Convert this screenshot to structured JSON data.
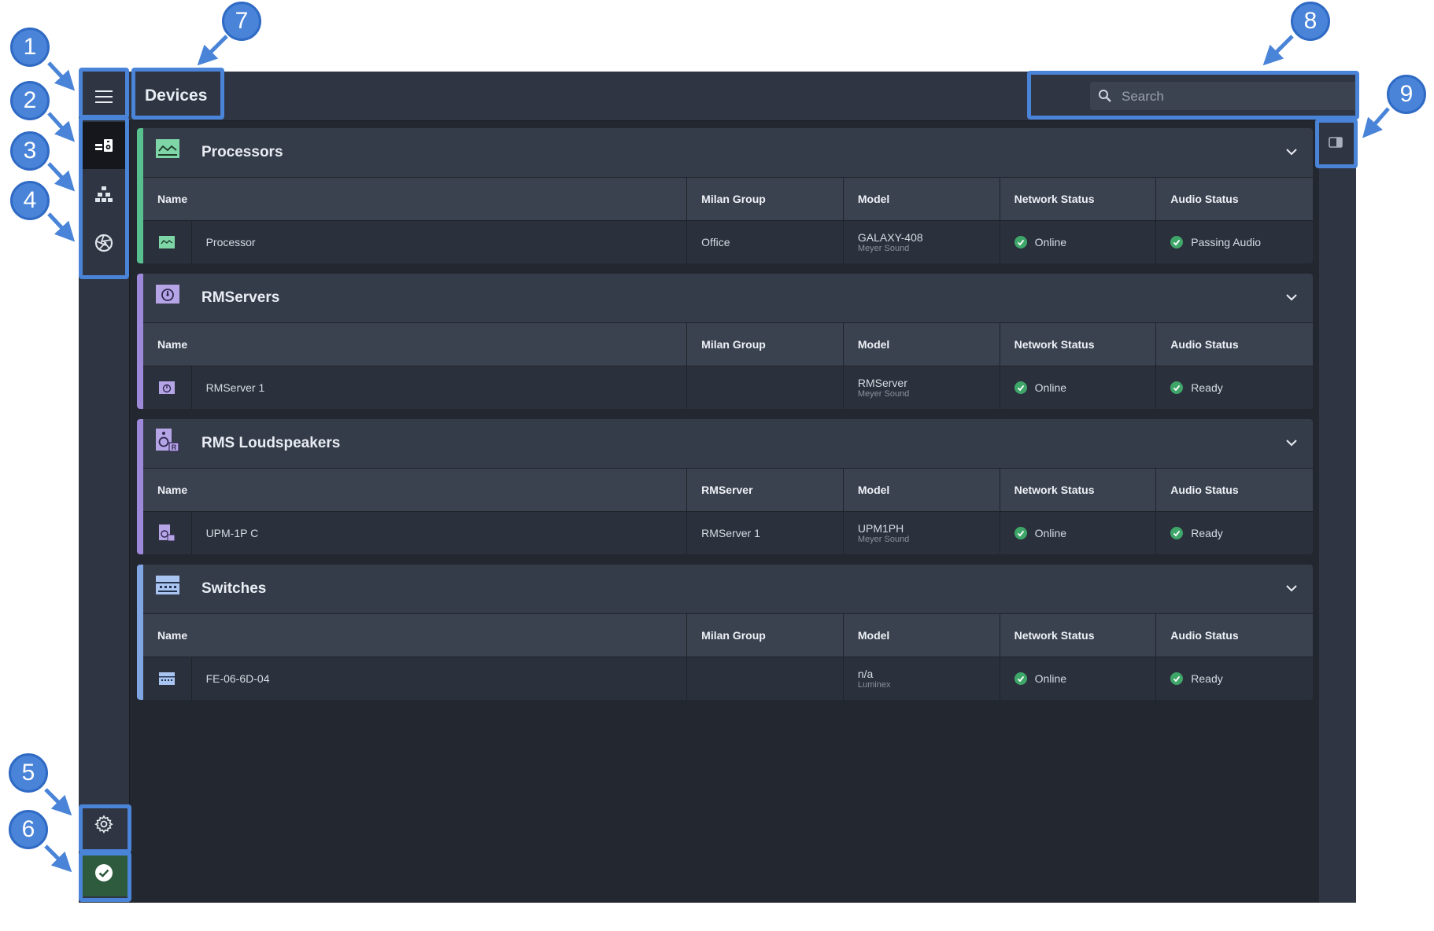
{
  "app": {
    "title": "Devices",
    "search": {
      "placeholder": "Search",
      "value": ""
    }
  },
  "sidebar": {
    "items": [
      {
        "name": "menu",
        "icon": "hamburger-icon"
      },
      {
        "name": "devices",
        "icon": "devices-icon",
        "active": true
      },
      {
        "name": "network",
        "icon": "network-tree-icon"
      },
      {
        "name": "aperture",
        "icon": "aperture-icon"
      },
      {
        "name": "settings",
        "icon": "gear-icon"
      },
      {
        "name": "status",
        "icon": "check-circle-icon"
      }
    ]
  },
  "groups": [
    {
      "title": "Processors",
      "color": "#58c08f",
      "icon": "processor-icon",
      "columns": [
        "Name",
        "Milan Group",
        "Model",
        "Network Status",
        "Audio Status"
      ],
      "rows": [
        {
          "name": "Processor",
          "col2": "Office",
          "model": "GALAXY-408",
          "maker": "Meyer Sound",
          "network": "Online",
          "audio": "Passing Audio"
        }
      ]
    },
    {
      "title": "RMServers",
      "color": "#9d88d9",
      "icon": "rmserver-icon",
      "columns": [
        "Name",
        "Milan Group",
        "Model",
        "Network Status",
        "Audio Status"
      ],
      "rows": [
        {
          "name": "RMServer 1",
          "col2": "",
          "model": "RMServer",
          "maker": "Meyer Sound",
          "network": "Online",
          "audio": "Ready"
        }
      ]
    },
    {
      "title": "RMS Loudspeakers",
      "color": "#9d88d9",
      "icon": "loudspeaker-icon",
      "columns": [
        "Name",
        "RMServer",
        "Model",
        "Network Status",
        "Audio Status"
      ],
      "rows": [
        {
          "name": "UPM-1P C",
          "col2": "RMServer 1",
          "model": "UPM1PH",
          "maker": "Meyer Sound",
          "network": "Online",
          "audio": "Ready"
        }
      ]
    },
    {
      "title": "Switches",
      "color": "#7fa6e3",
      "icon": "switch-icon",
      "columns": [
        "Name",
        "Milan Group",
        "Model",
        "Network Status",
        "Audio Status"
      ],
      "rows": [
        {
          "name": "FE-06-6D-04",
          "col2": "",
          "model": "n/a",
          "maker": "Luminex",
          "network": "Online",
          "audio": "Ready"
        }
      ]
    }
  ],
  "callouts": [
    "1",
    "2",
    "3",
    "4",
    "5",
    "6",
    "7",
    "8",
    "9"
  ],
  "colors": {
    "accent": "#4a84d8",
    "online": "#3fa66a",
    "bg": "#23272f"
  }
}
